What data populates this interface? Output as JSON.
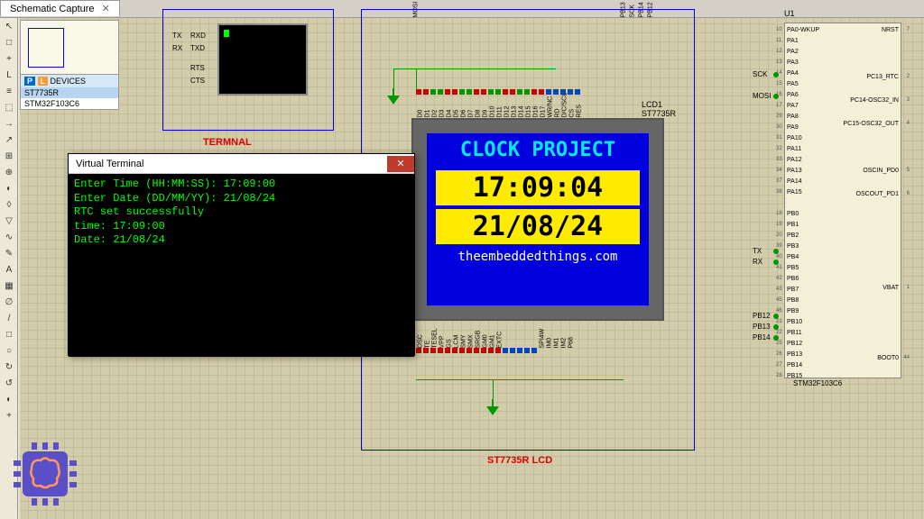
{
  "tab": {
    "title": "Schematic Capture",
    "close": "✕"
  },
  "devices_panel": {
    "badge1": "P",
    "badge2": "L",
    "header": "DEVICES",
    "items": [
      "ST7735R",
      "STM32F103C6"
    ]
  },
  "terminal_comp": {
    "label": "TERMNAL",
    "pins_left": [
      "TX",
      "RX"
    ],
    "pins_right": [
      "RXD",
      "TXD",
      "RTS",
      "CTS"
    ]
  },
  "lcd_comp": {
    "block_label": "ST7735R LCD",
    "ref": "LCD1",
    "part": "ST7735R",
    "title": "CLOCK PROJECT",
    "time": "17:09:04",
    "date": "21/08/24",
    "url": "theembeddedthings.com",
    "top_ext": [
      "MOSI",
      "PB13",
      "SCK",
      "PB14",
      "PB12"
    ],
    "pins_top": [
      "D0",
      "D1",
      "D2",
      "D3",
      "D4",
      "D5",
      "D6",
      "D7",
      "D8",
      "D9",
      "D10",
      "D11",
      "D12",
      "D13",
      "D14",
      "D15",
      "D16",
      "D17",
      "WR/NC",
      "RD",
      "D/C/SCL",
      "CS",
      "RES"
    ],
    "pins_bot": [
      "OSC",
      "TE",
      "TESEL",
      "VPP",
      "GS",
      "LCM",
      "SMY",
      "SMX",
      "SRGB",
      "GM0",
      "GM1",
      "EXTC",
      "SPI4W",
      "IM0",
      "IM1",
      "IM2",
      "P68"
    ]
  },
  "mcu": {
    "ref": "U1",
    "name": "STM32F103C6",
    "left_pins": [
      "PA0-WKUP",
      "PA1",
      "PA2",
      "PA3",
      "PA4",
      "PA5",
      "PA6",
      "PA7",
      "PA8",
      "PA9",
      "PA10",
      "PA11",
      "PA12",
      "PA13",
      "PA14",
      "PA15",
      "",
      "PB0",
      "PB1",
      "PB2",
      "PB3",
      "PB4",
      "PB5",
      "PB6",
      "PB7",
      "PB8",
      "PB9",
      "PB10",
      "PB11",
      "PB12",
      "PB13",
      "PB14",
      "PB15"
    ],
    "left_nums": [
      "10",
      "11",
      "12",
      "13",
      "14",
      "15",
      "16",
      "17",
      "29",
      "30",
      "31",
      "32",
      "33",
      "34",
      "37",
      "38",
      "",
      "18",
      "19",
      "20",
      "39",
      "40",
      "41",
      "42",
      "43",
      "45",
      "46",
      "21",
      "22",
      "25",
      "26",
      "27",
      "28"
    ],
    "right_pins": [
      "NRST",
      "",
      "PC13_RTC",
      "PC14-OSC32_IN",
      "PC15-OSC32_OUT",
      "",
      "OSCIN_PD0",
      "OSCOUT_PD1",
      "",
      "",
      "",
      "VBAT",
      "",
      "",
      "BOOT0"
    ],
    "right_nums": [
      "7",
      "",
      "2",
      "3",
      "4",
      "",
      "5",
      "6",
      "",
      "",
      "",
      "1",
      "",
      "",
      "44"
    ],
    "ext_left": [
      "SCK",
      "MOSI",
      "TX",
      "RX",
      "PB12",
      "PB13",
      "PB14"
    ]
  },
  "vt": {
    "title": "Virtual Terminal",
    "lines": [
      "Enter Time (HH:MM:SS): 17:09:00",
      "Enter Date (DD/MM/YY): 21/08/24",
      "RTC set successfully",
      "time: 17:09:00",
      "Date: 21/08/24"
    ]
  },
  "toolbar_icons": [
    "↖",
    "□",
    "+",
    "L",
    "≡",
    "⬚",
    "→",
    "↗",
    "⊞",
    "⊕",
    "◐",
    "◊",
    "▽",
    "∿",
    "✎",
    "A",
    "▦",
    "∅",
    "/",
    "□",
    "○",
    "↻",
    "↺",
    "◐",
    "+"
  ]
}
